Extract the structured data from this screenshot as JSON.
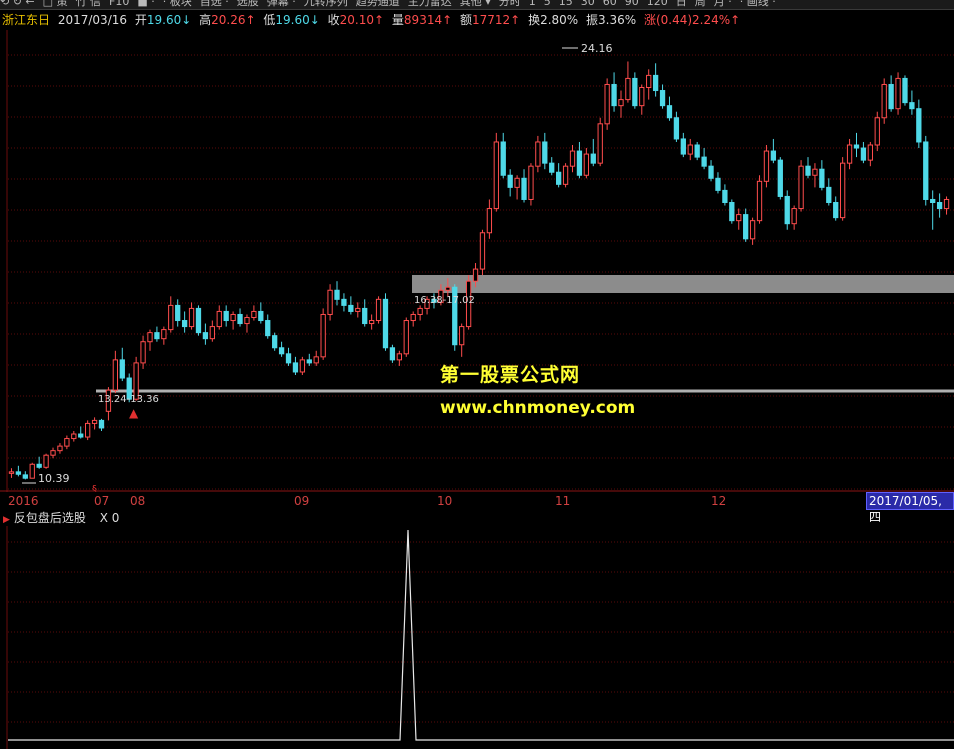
{
  "toolbar": {
    "items": [
      "⟲ ↻ ←",
      "□ 策",
      "竹 信",
      "F10",
      "■ ·",
      "· 板块",
      "自选 ·",
      "选股",
      "弹幕 ·",
      "九转序列",
      "趋势通道",
      "主力雷达",
      "其他 ▾",
      "分时",
      "1",
      "5",
      "15",
      "30",
      "60",
      "90",
      "120",
      "日",
      "周",
      "月 ·",
      "· 画线 ·"
    ]
  },
  "info": {
    "stock_name": "浙江东日",
    "date": "2017/03/16",
    "open_label": "开",
    "open_value": "19.60↓",
    "high_label": "高",
    "high_value": "20.26↑",
    "low_label": "低",
    "low_value": "19.60↓",
    "close_label": "收",
    "close_value": "20.10↑",
    "volume_label": "量",
    "volume_value": "89314↑",
    "amount_label": "额",
    "amount_value": "17712↑",
    "turnover": "换2.80%",
    "amplitude": "振3.36%",
    "change": "涨(0.44)2.24%↑"
  },
  "chart": {
    "max_annotation": "24.16",
    "min_annotation": "10.39",
    "zone_upper_label": "16.38-17.02",
    "zone_lower_label": "13.24-13.36",
    "zone_upper_color": "#8c8c8c",
    "zone_lower_color": "#b0b0b0",
    "up_color": "#ff4d4d",
    "down_color": "#4fd9e8",
    "x_axis": [
      "2016",
      "07",
      "08",
      "09",
      "10",
      "11",
      "12"
    ],
    "x_axis_highlight": "2017/01/05,四"
  },
  "chart_data": {
    "type": "candlestick",
    "title": "",
    "xlabel": "",
    "ylabel": "",
    "x_range": [
      "2016-06",
      "2017-03"
    ],
    "ylim": [
      10.0,
      25.2
    ],
    "grid": "horizontal dotted",
    "candles": [
      [
        10.55,
        10.72,
        10.4,
        10.6
      ],
      [
        10.6,
        10.8,
        10.45,
        10.52
      ],
      [
        10.5,
        10.62,
        10.35,
        10.39
      ],
      [
        10.39,
        10.9,
        10.39,
        10.85
      ],
      [
        10.85,
        11.1,
        10.7,
        10.75
      ],
      [
        10.75,
        11.2,
        10.7,
        11.15
      ],
      [
        11.15,
        11.4,
        11.05,
        11.3
      ],
      [
        11.3,
        11.55,
        11.2,
        11.45
      ],
      [
        11.45,
        11.8,
        11.35,
        11.7
      ],
      [
        11.7,
        11.95,
        11.6,
        11.85
      ],
      [
        11.85,
        12.1,
        11.7,
        11.75
      ],
      [
        11.75,
        12.3,
        11.65,
        12.2
      ],
      [
        12.2,
        12.4,
        12.0,
        12.3
      ],
      [
        12.3,
        12.35,
        11.95,
        12.05
      ],
      [
        12.6,
        13.4,
        12.3,
        13.3
      ],
      [
        13.3,
        14.6,
        13.2,
        14.3
      ],
      [
        14.3,
        14.7,
        13.6,
        13.7
      ],
      [
        13.7,
        13.85,
        12.9,
        13.0
      ],
      [
        13.0,
        14.4,
        12.95,
        14.2
      ],
      [
        14.2,
        15.1,
        14.0,
        14.9
      ],
      [
        14.9,
        15.3,
        14.6,
        15.2
      ],
      [
        15.2,
        15.4,
        14.9,
        15.0
      ],
      [
        15.0,
        15.4,
        14.8,
        15.3
      ],
      [
        15.3,
        16.4,
        15.2,
        16.1
      ],
      [
        16.1,
        16.3,
        15.4,
        15.6
      ],
      [
        15.6,
        15.9,
        15.2,
        15.4
      ],
      [
        15.4,
        16.2,
        15.3,
        16.0
      ],
      [
        16.0,
        16.1,
        15.1,
        15.2
      ],
      [
        15.2,
        15.5,
        14.8,
        15.0
      ],
      [
        15.0,
        15.6,
        14.9,
        15.4
      ],
      [
        15.4,
        16.1,
        15.3,
        15.9
      ],
      [
        15.9,
        16.1,
        15.4,
        15.6
      ],
      [
        15.6,
        15.9,
        15.3,
        15.8
      ],
      [
        15.8,
        16.0,
        15.4,
        15.5
      ],
      [
        15.5,
        15.8,
        15.2,
        15.7
      ],
      [
        15.7,
        16.1,
        15.6,
        15.9
      ],
      [
        15.9,
        16.2,
        15.5,
        15.6
      ],
      [
        15.6,
        15.8,
        15.0,
        15.1
      ],
      [
        15.1,
        15.2,
        14.6,
        14.7
      ],
      [
        14.7,
        14.9,
        14.4,
        14.5
      ],
      [
        14.5,
        14.7,
        14.1,
        14.2
      ],
      [
        14.2,
        14.4,
        13.8,
        13.9
      ],
      [
        13.9,
        14.4,
        13.8,
        14.3
      ],
      [
        14.3,
        14.5,
        14.1,
        14.2
      ],
      [
        14.2,
        14.6,
        14.1,
        14.4
      ],
      [
        14.4,
        16.0,
        14.3,
        15.8
      ],
      [
        15.8,
        16.8,
        15.6,
        16.6
      ],
      [
        16.6,
        16.9,
        16.1,
        16.3
      ],
      [
        16.3,
        16.5,
        15.9,
        16.1
      ],
      [
        16.1,
        16.4,
        15.8,
        15.9
      ],
      [
        15.9,
        16.2,
        15.7,
        16.0
      ],
      [
        16.0,
        16.3,
        15.4,
        15.5
      ],
      [
        15.5,
        15.8,
        15.3,
        15.6
      ],
      [
        15.6,
        16.4,
        15.5,
        16.3
      ],
      [
        16.3,
        16.5,
        14.6,
        14.7
      ],
      [
        14.7,
        14.8,
        14.2,
        14.3
      ],
      [
        14.3,
        14.6,
        14.1,
        14.5
      ],
      [
        14.5,
        15.7,
        14.4,
        15.6
      ],
      [
        15.6,
        15.9,
        15.4,
        15.8
      ],
      [
        15.8,
        16.1,
        15.6,
        16.0
      ],
      [
        16.0,
        16.4,
        15.8,
        16.3
      ],
      [
        16.3,
        16.5,
        16.0,
        16.2
      ],
      [
        16.2,
        16.8,
        16.1,
        16.6
      ],
      [
        16.6,
        17.0,
        16.4,
        16.7
      ],
      [
        16.7,
        16.8,
        14.6,
        14.8
      ],
      [
        14.8,
        15.5,
        14.4,
        15.4
      ],
      [
        15.4,
        17.1,
        15.3,
        16.9
      ],
      [
        16.9,
        17.5,
        16.7,
        17.3
      ],
      [
        17.3,
        18.6,
        17.1,
        18.5
      ],
      [
        18.5,
        19.6,
        18.3,
        19.3
      ],
      [
        19.3,
        21.8,
        19.2,
        21.5
      ],
      [
        21.5,
        21.8,
        20.3,
        20.4
      ],
      [
        20.4,
        20.6,
        19.7,
        20.0
      ],
      [
        20.0,
        20.4,
        19.6,
        20.3
      ],
      [
        20.3,
        20.6,
        19.5,
        19.6
      ],
      [
        19.6,
        20.8,
        19.4,
        20.7
      ],
      [
        20.7,
        21.7,
        20.5,
        21.5
      ],
      [
        21.5,
        21.8,
        20.6,
        20.8
      ],
      [
        20.8,
        21.0,
        20.4,
        20.5
      ],
      [
        20.5,
        20.8,
        20.0,
        20.1
      ],
      [
        20.1,
        20.8,
        20.0,
        20.7
      ],
      [
        20.7,
        21.4,
        20.5,
        21.2
      ],
      [
        21.2,
        21.5,
        20.3,
        20.4
      ],
      [
        20.4,
        21.3,
        20.3,
        21.1
      ],
      [
        21.1,
        21.6,
        20.7,
        20.8
      ],
      [
        20.8,
        22.3,
        20.7,
        22.1
      ],
      [
        22.1,
        23.6,
        21.9,
        23.4
      ],
      [
        23.4,
        23.8,
        22.5,
        22.7
      ],
      [
        22.7,
        23.2,
        22.3,
        22.9
      ],
      [
        22.9,
        24.16,
        22.8,
        23.6
      ],
      [
        23.6,
        23.8,
        22.6,
        22.7
      ],
      [
        22.7,
        23.4,
        22.4,
        23.3
      ],
      [
        23.3,
        23.9,
        22.9,
        23.7
      ],
      [
        23.7,
        24.1,
        23.0,
        23.2
      ],
      [
        23.2,
        23.4,
        22.6,
        22.7
      ],
      [
        22.7,
        23.0,
        22.2,
        22.3
      ],
      [
        22.3,
        22.5,
        21.5,
        21.6
      ],
      [
        21.6,
        21.8,
        21.0,
        21.1
      ],
      [
        21.1,
        21.6,
        20.9,
        21.4
      ],
      [
        21.4,
        21.5,
        20.9,
        21.0
      ],
      [
        21.0,
        21.3,
        20.6,
        20.7
      ],
      [
        20.7,
        20.9,
        20.2,
        20.3
      ],
      [
        20.3,
        20.5,
        19.8,
        19.9
      ],
      [
        19.9,
        20.1,
        19.4,
        19.5
      ],
      [
        19.5,
        19.6,
        18.8,
        18.9
      ],
      [
        18.9,
        19.3,
        18.6,
        19.1
      ],
      [
        19.1,
        19.3,
        18.2,
        18.3
      ],
      [
        18.3,
        19.0,
        18.1,
        18.9
      ],
      [
        18.9,
        20.4,
        18.8,
        20.2
      ],
      [
        20.2,
        21.4,
        20.0,
        21.2
      ],
      [
        21.2,
        21.6,
        20.8,
        20.9
      ],
      [
        20.9,
        21.0,
        19.6,
        19.7
      ],
      [
        19.7,
        19.9,
        18.6,
        18.8
      ],
      [
        18.8,
        19.4,
        18.6,
        19.3
      ],
      [
        19.3,
        20.9,
        19.2,
        20.7
      ],
      [
        20.7,
        21.0,
        20.3,
        20.4
      ],
      [
        20.4,
        20.8,
        20.0,
        20.6
      ],
      [
        20.6,
        20.9,
        19.9,
        20.0
      ],
      [
        20.0,
        20.3,
        19.4,
        19.5
      ],
      [
        19.5,
        19.7,
        18.9,
        19.0
      ],
      [
        19.0,
        21.0,
        18.9,
        20.8
      ],
      [
        20.8,
        21.6,
        20.6,
        21.4
      ],
      [
        21.4,
        21.8,
        21.0,
        21.3
      ],
      [
        21.3,
        21.5,
        20.8,
        20.9
      ],
      [
        20.9,
        21.5,
        20.7,
        21.4
      ],
      [
        21.4,
        22.5,
        21.2,
        22.3
      ],
      [
        22.3,
        23.6,
        22.1,
        23.4
      ],
      [
        23.4,
        23.7,
        22.5,
        22.6
      ],
      [
        22.6,
        23.8,
        22.4,
        23.6
      ],
      [
        23.6,
        23.7,
        22.7,
        22.8
      ],
      [
        22.8,
        23.2,
        22.4,
        22.6
      ],
      [
        22.6,
        22.9,
        21.3,
        21.5
      ],
      [
        21.5,
        21.7,
        19.4,
        19.6
      ],
      [
        19.6,
        19.9,
        18.6,
        19.5
      ],
      [
        19.5,
        19.8,
        19.0,
        19.3
      ],
      [
        19.3,
        19.7,
        19.1,
        19.6
      ]
    ]
  },
  "indicator": {
    "name": "反包盘后选股",
    "value": "X 0"
  },
  "watermark": {
    "line1": "第一股票公式网",
    "line2": "www.chnmoney.com"
  }
}
